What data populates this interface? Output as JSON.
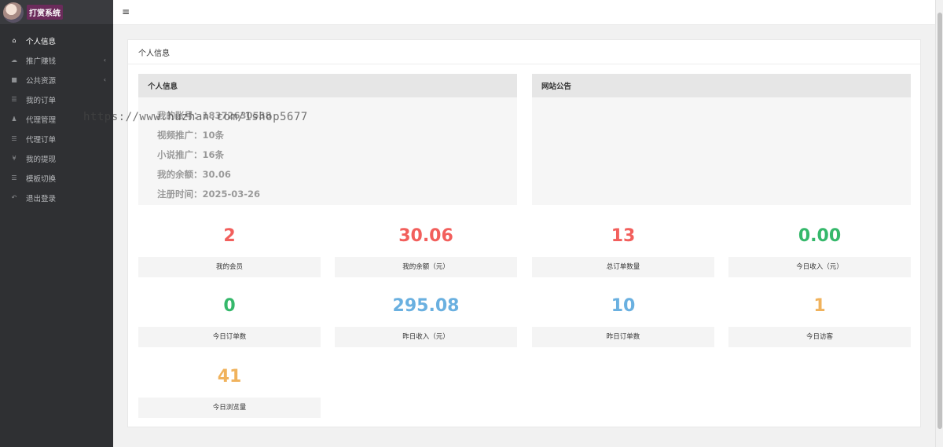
{
  "brand": {
    "title": "打赏系统"
  },
  "sidebar": {
    "items": [
      {
        "label": "个人信息",
        "icon": "home-icon",
        "glyph": "⌂",
        "active": true,
        "expandable": false
      },
      {
        "label": "推广赚钱",
        "icon": "cloud-icon",
        "glyph": "☁",
        "active": false,
        "expandable": true
      },
      {
        "label": "公共资源",
        "icon": "video-icon",
        "glyph": "■",
        "active": false,
        "expandable": true
      },
      {
        "label": "我的订单",
        "icon": "list-icon",
        "glyph": "☰",
        "active": false,
        "expandable": false
      },
      {
        "label": "代理管理",
        "icon": "users-icon",
        "glyph": "♟",
        "active": false,
        "expandable": false
      },
      {
        "label": "代理订单",
        "icon": "list-icon",
        "glyph": "☰",
        "active": false,
        "expandable": false
      },
      {
        "label": "我的提现",
        "icon": "yen-icon",
        "glyph": "¥",
        "active": false,
        "expandable": false
      },
      {
        "label": "模板切换",
        "icon": "list-icon",
        "glyph": "☰",
        "active": false,
        "expandable": false
      },
      {
        "label": "退出登录",
        "icon": "reply-icon",
        "glyph": "↶",
        "active": false,
        "expandable": false
      }
    ]
  },
  "topbar": {
    "menu_icon": "≡"
  },
  "card": {
    "title": "个人信息"
  },
  "info_panel": {
    "title": "个人信息",
    "lines": [
      "我的账号：18372630538",
      "视频推广：10条",
      "小说推广：16条",
      "我的余额：30.06",
      "注册时间：2025-03-26"
    ]
  },
  "notice_panel": {
    "title": "网站公告"
  },
  "watermark": "https://www.huzhan.com/1shop5677",
  "stats": [
    {
      "value": "2",
      "label": "我的会员",
      "color": "#f25f5c"
    },
    {
      "value": "30.06",
      "label": "我的余额（元）",
      "color": "#f25f5c"
    },
    {
      "value": "13",
      "label": "总订单数量",
      "color": "#f25f5c"
    },
    {
      "value": "0.00",
      "label": "今日收入（元）",
      "color": "#35b86b"
    },
    {
      "value": "0",
      "label": "今日订单数",
      "color": "#35b86b"
    },
    {
      "value": "295.08",
      "label": "昨日收入（元）",
      "color": "#6ab0e0"
    },
    {
      "value": "10",
      "label": "昨日订单数",
      "color": "#6ab0e0"
    },
    {
      "value": "1",
      "label": "今日访客",
      "color": "#f0b25c"
    },
    {
      "value": "41",
      "label": "今日浏览量",
      "color": "#f0b25c"
    }
  ]
}
